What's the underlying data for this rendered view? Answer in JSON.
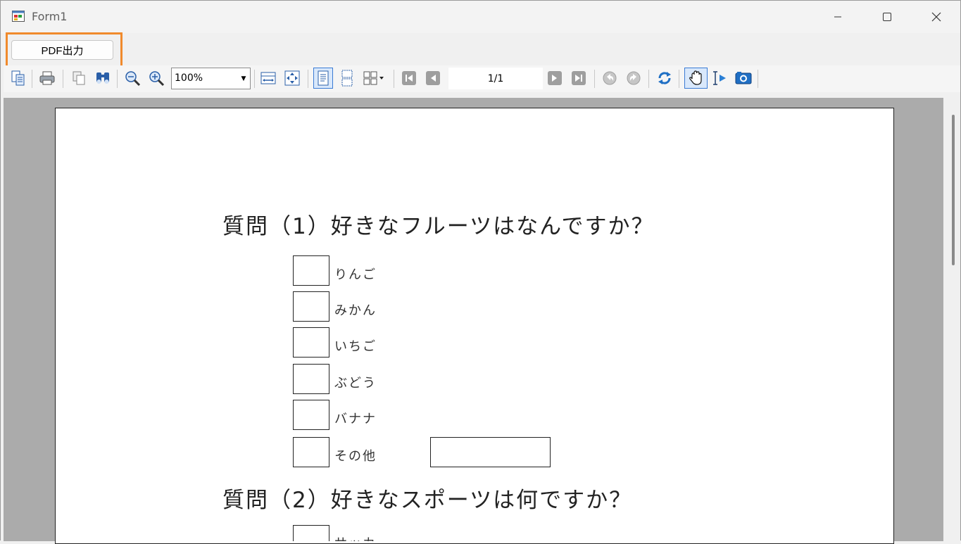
{
  "window": {
    "title": "Form1"
  },
  "menu": {
    "pdf_button_label": "PDF出力"
  },
  "toolbar": {
    "zoom_value": "100%",
    "page_indicator": "1/1",
    "icons": [
      "page-setup-icon",
      "print-icon",
      "copy-icon",
      "find-icon",
      "zoom-out-icon",
      "zoom-in-icon",
      "page-width-icon",
      "whole-page-icon",
      "single-page-icon",
      "continuous-pages-icon",
      "multiple-pages-icon",
      "first-page-icon",
      "previous-page-icon",
      "next-page-icon",
      "last-page-icon",
      "back-icon",
      "forward-icon",
      "refresh-icon",
      "hand-tool-icon",
      "select-text-icon",
      "snapshot-icon"
    ]
  },
  "document": {
    "question1": "質問（1）好きなフルーツはなんですか？",
    "q1_options": [
      "りんご",
      "みかん",
      "いちご",
      "ぶどう",
      "バナナ",
      "その他"
    ],
    "question2": "質問（2）好きなスポーツは何ですか？",
    "q2_first_option_partial": "サッカ"
  },
  "colors": {
    "highlight": "#f08a2c",
    "viewer_background": "#ababab",
    "active_toolbar_button": "#3a7bd5"
  }
}
